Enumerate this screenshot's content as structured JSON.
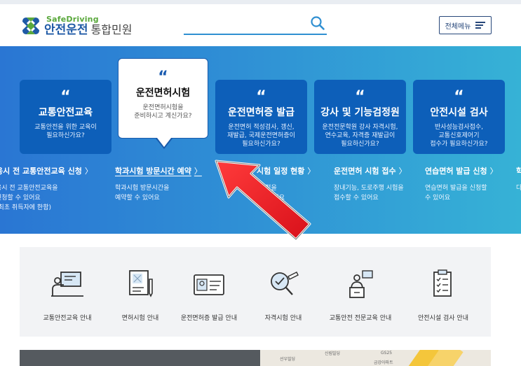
{
  "header": {
    "logo_sub": "SafeDriving",
    "logo_main": "안전운전",
    "logo_suffix": "통합민원",
    "search_placeholder": "",
    "menu_label": "전체메뉴"
  },
  "hero": {
    "cards": [
      {
        "title": "교통안전교육",
        "desc": "교통안전을 위한 교육이\n필요하신가요?"
      },
      {
        "title": "운전면허시험",
        "desc": "운전면허시험을\n준비하시고 계신가요?"
      },
      {
        "title": "운전면허증 발급",
        "desc": "운전면허 적성검사, 갱신,\n재발급, 국제운전면허증이\n필요하신가요?"
      },
      {
        "title": "강사 및 기능검정원",
        "desc": "운전전문학원 강사 자격시험,\n연수교육, 자격증 재발급이\n필요하신가요?"
      },
      {
        "title": "안전시설 검사",
        "desc": "반사성능검사접수,\n교통신호제어기\n접수가 필요하신가요?"
      }
    ],
    "quote_mark": "“",
    "links": [
      {
        "label": "응시 전 교통안전교육 신청",
        "desc": "응시 전 교통안전교육을\n신청할 수 있어요\n(최초 취득자에 한함)"
      },
      {
        "label": "학과시험 방문시간 예약",
        "desc": "학과시험 방문시간을\n예약할 수 있어요"
      },
      {
        "label": "시험 일정 현황",
        "desc": "일정을\n수 있어요"
      },
      {
        "label": "운전면허 시험 접수",
        "desc": "장내기능, 도로주행 시험을\n접수할 수 있어요"
      },
      {
        "label": "연습면허 발급 신청",
        "desc": "연습면허 발급을 신청할\n수 있어요"
      },
      {
        "label": "학",
        "desc": "다"
      }
    ],
    "chevron": "〉"
  },
  "services": [
    {
      "label": "교통안전교육 안내",
      "icon": "presentation-icon"
    },
    {
      "label": "면허시험 안내",
      "icon": "document-pen-icon"
    },
    {
      "label": "운전면허증 발급 안내",
      "icon": "id-card-icon"
    },
    {
      "label": "자격시험 안내",
      "icon": "search-check-icon"
    },
    {
      "label": "교통안전 전문교육 안내",
      "icon": "lecture-podium-icon"
    },
    {
      "label": "안전시설 검사 안내",
      "icon": "checklist-icon"
    }
  ],
  "map": {
    "labels": [
      "선우빌딩",
      "신림빌딩",
      "GS25",
      "금강아파트"
    ]
  },
  "colors": {
    "brand_blue": "#1f5aa6",
    "card_blue": "#0d5fb9",
    "brand_green": "#5aa83c",
    "annotation_red": "#e8161f"
  }
}
